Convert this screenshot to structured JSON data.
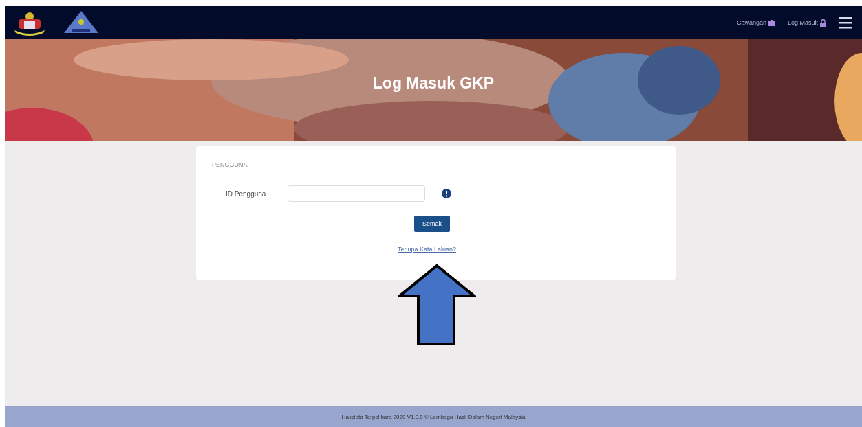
{
  "navbar": {
    "links": [
      {
        "label": "Cawangan"
      },
      {
        "label": "Log Masuk"
      }
    ]
  },
  "banner": {
    "title": "Log Masuk GKP",
    "kind": "picture"
  },
  "form": {
    "section_title": "PENGGUNA",
    "fields": [
      {
        "label": "ID Pengguna"
      }
    ],
    "submit": "Semak",
    "link": "Terlupa Kata Laluan?"
  },
  "footer": {
    "text": "Hakcipta Terpelihara 2020 V1.0.0 © Lembaga Hasil Dalam Negeri Malaysia"
  }
}
